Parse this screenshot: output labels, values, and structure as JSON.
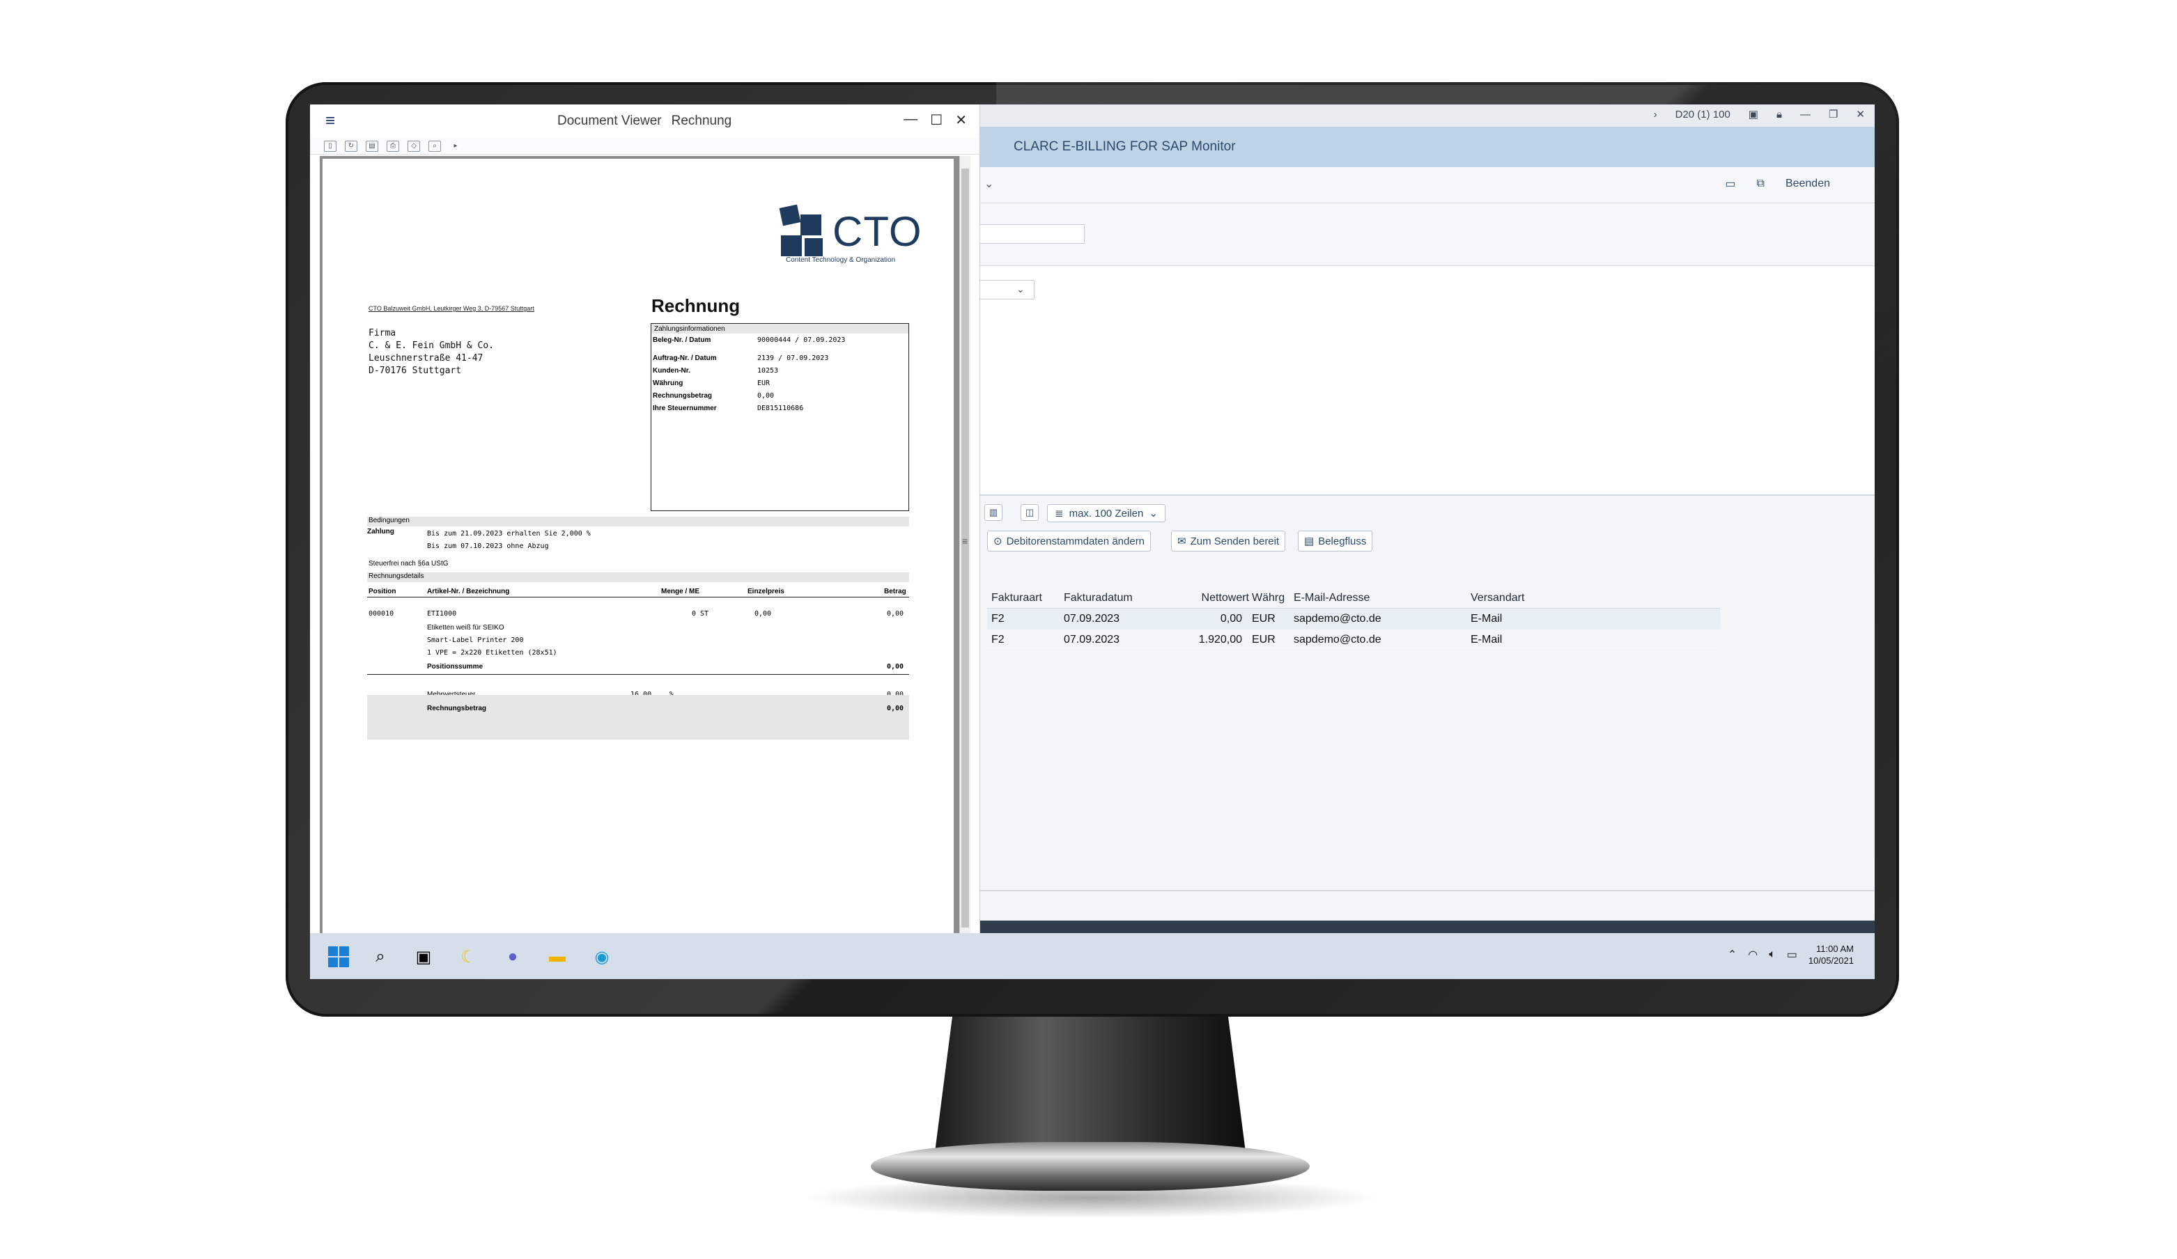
{
  "viewer": {
    "window_title": "Document Viewer",
    "doc_name": "Rechnung",
    "menu_icon": "hamburger-icon",
    "controls": [
      "minimize-icon",
      "maximize-icon",
      "close-icon"
    ]
  },
  "document": {
    "logo_text": "CTO",
    "logo_sub": "Content Technology & Organization",
    "sender_line": "CTO Balzuweit GmbH, Leutkirger Weg 3, D-79567 Stuttgart",
    "title": "Rechnung",
    "address": [
      "Firma",
      "C. & E. Fein GmbH & Co.",
      "Leuschnerstraße 41-47",
      "D-70176 Stuttgart"
    ],
    "payment_info_header": "Zahlungsinformationen",
    "payment_info": [
      {
        "label": "Beleg-Nr. / Datum",
        "value": "90000444 / 07.09.2023"
      },
      {
        "label": "Auftrag-Nr. / Datum",
        "value": "2139 / 07.09.2023"
      },
      {
        "label": "Kunden-Nr.",
        "value": "10253"
      },
      {
        "label": "Währung",
        "value": "EUR"
      },
      {
        "label": "Rechnungsbetrag",
        "value": "0,00"
      },
      {
        "label": "Ihre Steuernummer",
        "value": "DE815110686"
      }
    ],
    "conditions_header": "Bedingungen",
    "payment_label": "Zahlung",
    "payment_terms": [
      "Bis zum 21.09.2023 erhalten Sie 2,000  %",
      "Bis zum 07.10.2023 ohne Abzug"
    ],
    "tax_note": "Steuerfrei nach §6a UStG",
    "details_header": "Rechnungsdetails",
    "table_headers": {
      "position": "Position",
      "article": "Artikel-Nr. / Bezeichnung",
      "qty": "Menge / ME",
      "unit_price": "Einzelpreis",
      "amount": "Betrag"
    },
    "item": {
      "position": "000010",
      "article": "ETI1000",
      "desc1": "Etiketten weiß für SEIKO",
      "desc2": "Smart-Label Printer 200",
      "desc3": "1 VPE =  2x220 Etiketten (28x51)",
      "qty": "0  ST",
      "unit_price": "0,00",
      "amount": "0,00"
    },
    "position_sum_label": "Positionssumme",
    "position_sum": "0,00",
    "vat_label": "Mehrwertsteuer",
    "vat_rate": "16,00",
    "vat_unit": "%",
    "vat_amount": "0,00",
    "total_label": "Rechnungsbetrag",
    "total": "0,00"
  },
  "sap": {
    "system": "D20 (1) 100",
    "title": "CLARC E-BILLING FOR SAP Monitor",
    "exit_label": "Beenden",
    "rows_select": "max. 100 Zeilen",
    "buttons": {
      "edit_debtor": "Debitorenstammdaten ändern",
      "ready_send": "Zum Senden bereit",
      "doc_flow": "Belegfluss"
    },
    "grid_headers": [
      "Fakturaart",
      "Fakturadatum",
      "Nettowert",
      "Währg",
      "E-Mail-Adresse",
      "Versandart"
    ],
    "grid_rows": [
      [
        "F2",
        "07.09.2023",
        "0,00",
        "EUR",
        "sapdemo@cto.de",
        "E-Mail"
      ],
      [
        "F2",
        "07.09.2023",
        "1.920,00",
        "EUR",
        "sapdemo@cto.de",
        "E-Mail"
      ]
    ]
  },
  "taskbar": {
    "time": "11:00 AM",
    "date": "10/05/2021"
  },
  "colors": {
    "sap_header": "#bfd3e6",
    "cto_blue": "#1f3a5f",
    "taskbar": "#d6deea"
  }
}
